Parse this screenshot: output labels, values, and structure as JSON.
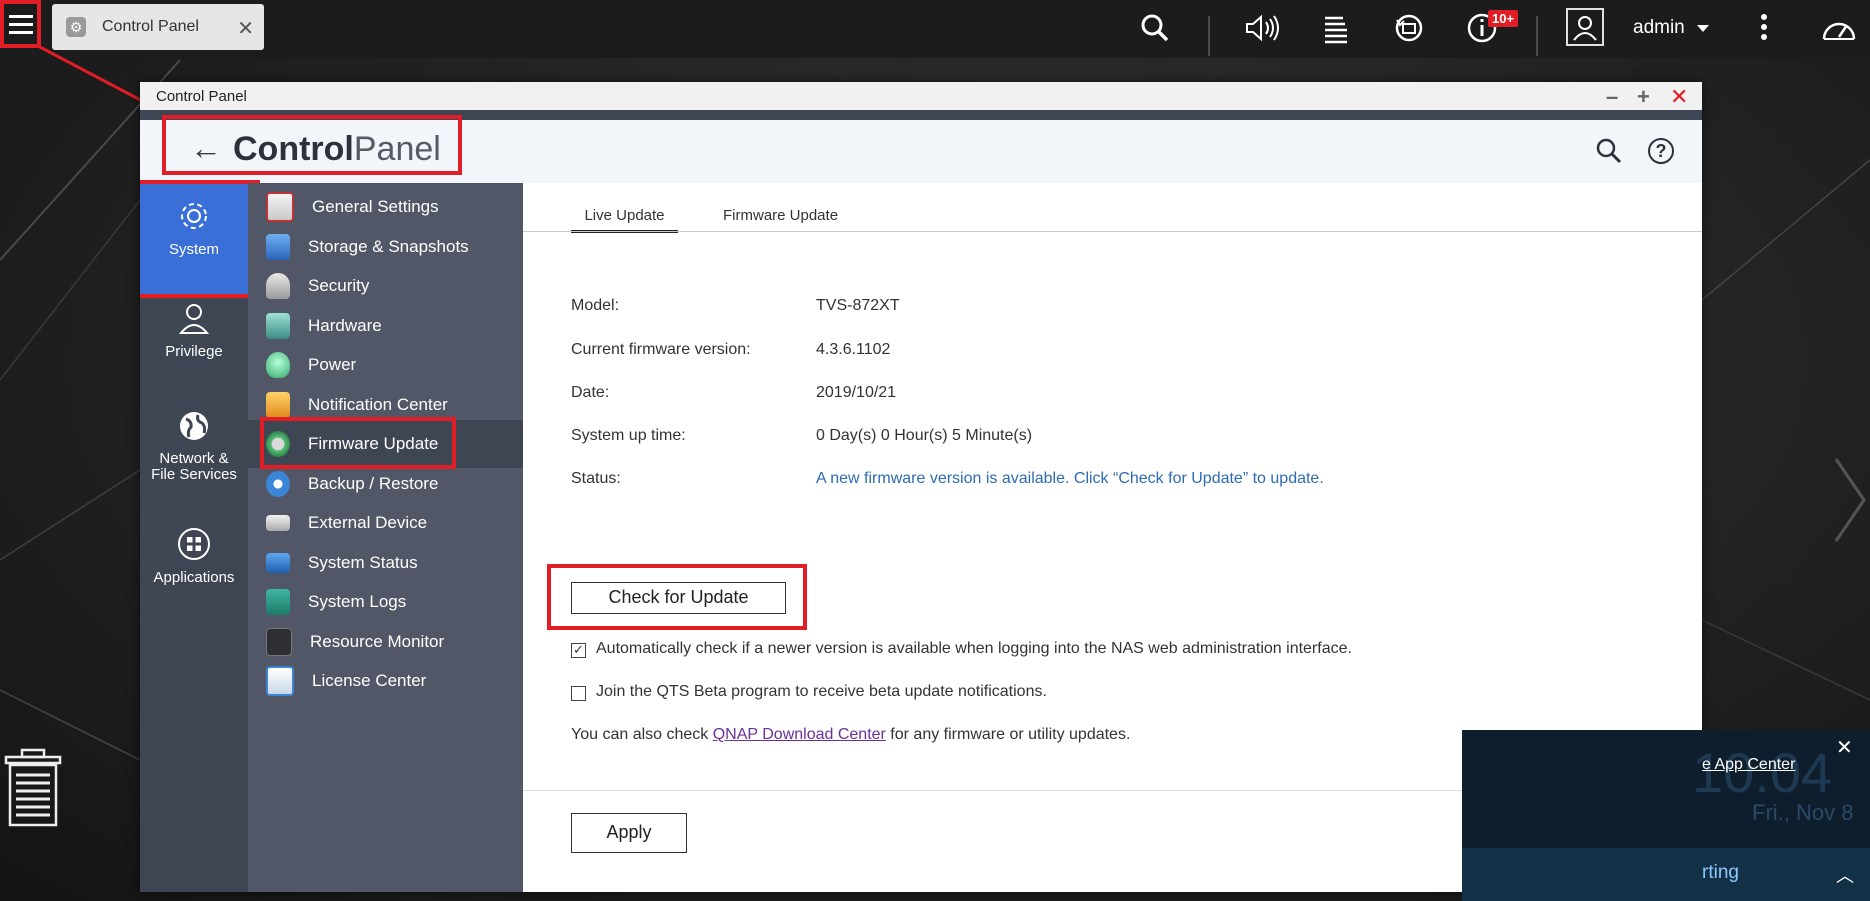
{
  "taskbar": {
    "tab_label": "Control Panel",
    "notification_badge": "10+",
    "user_name": "admin"
  },
  "window": {
    "title": "Control Panel",
    "heading_bold": "Control",
    "heading_light": "Panel"
  },
  "categories": [
    {
      "label": "System",
      "icon": "gear-icon"
    },
    {
      "label": "Privilege",
      "icon": "user-icon"
    },
    {
      "label": "Network &\nFile Services",
      "icon": "globe-icon"
    },
    {
      "label": "Applications",
      "icon": "apps-grid-icon"
    }
  ],
  "sub_menu": [
    {
      "label": "General Settings"
    },
    {
      "label": "Storage & Snapshots"
    },
    {
      "label": "Security"
    },
    {
      "label": "Hardware"
    },
    {
      "label": "Power"
    },
    {
      "label": "Notification Center"
    },
    {
      "label": "Firmware Update"
    },
    {
      "label": "Backup / Restore"
    },
    {
      "label": "External Device"
    },
    {
      "label": "System Status"
    },
    {
      "label": "System Logs"
    },
    {
      "label": "Resource Monitor"
    },
    {
      "label": "License Center"
    }
  ],
  "tabs": [
    "Live Update",
    "Firmware Update"
  ],
  "info": {
    "model_label": "Model:",
    "model_value": "TVS-872XT",
    "fw_label": "Current firmware version:",
    "fw_value": "4.3.6.1102",
    "date_label": "Date:",
    "date_value": "2019/10/21",
    "uptime_label": "System up time:",
    "uptime_value": "0 Day(s) 0 Hour(s) 5 Minute(s)",
    "status_label": "Status:",
    "status_value": "A new firmware version is available. Click “Check for Update” to update."
  },
  "check_button": "Check for Update",
  "options": {
    "auto_check_label": "Automatically check if a newer version is available when logging into the NAS web administration interface.",
    "auto_check_checked": true,
    "beta_label": "Join the QTS Beta program to receive beta update notifications.",
    "beta_checked": false
  },
  "note": {
    "prefix": "You can also check ",
    "link": "QNAP Download Center",
    "suffix": " for any firmware or utility updates."
  },
  "apply_button": "Apply",
  "widget": {
    "clock": "10:04",
    "date": "Fri., Nov 8",
    "link_text": "e App Center",
    "bottom_text": "rting"
  }
}
